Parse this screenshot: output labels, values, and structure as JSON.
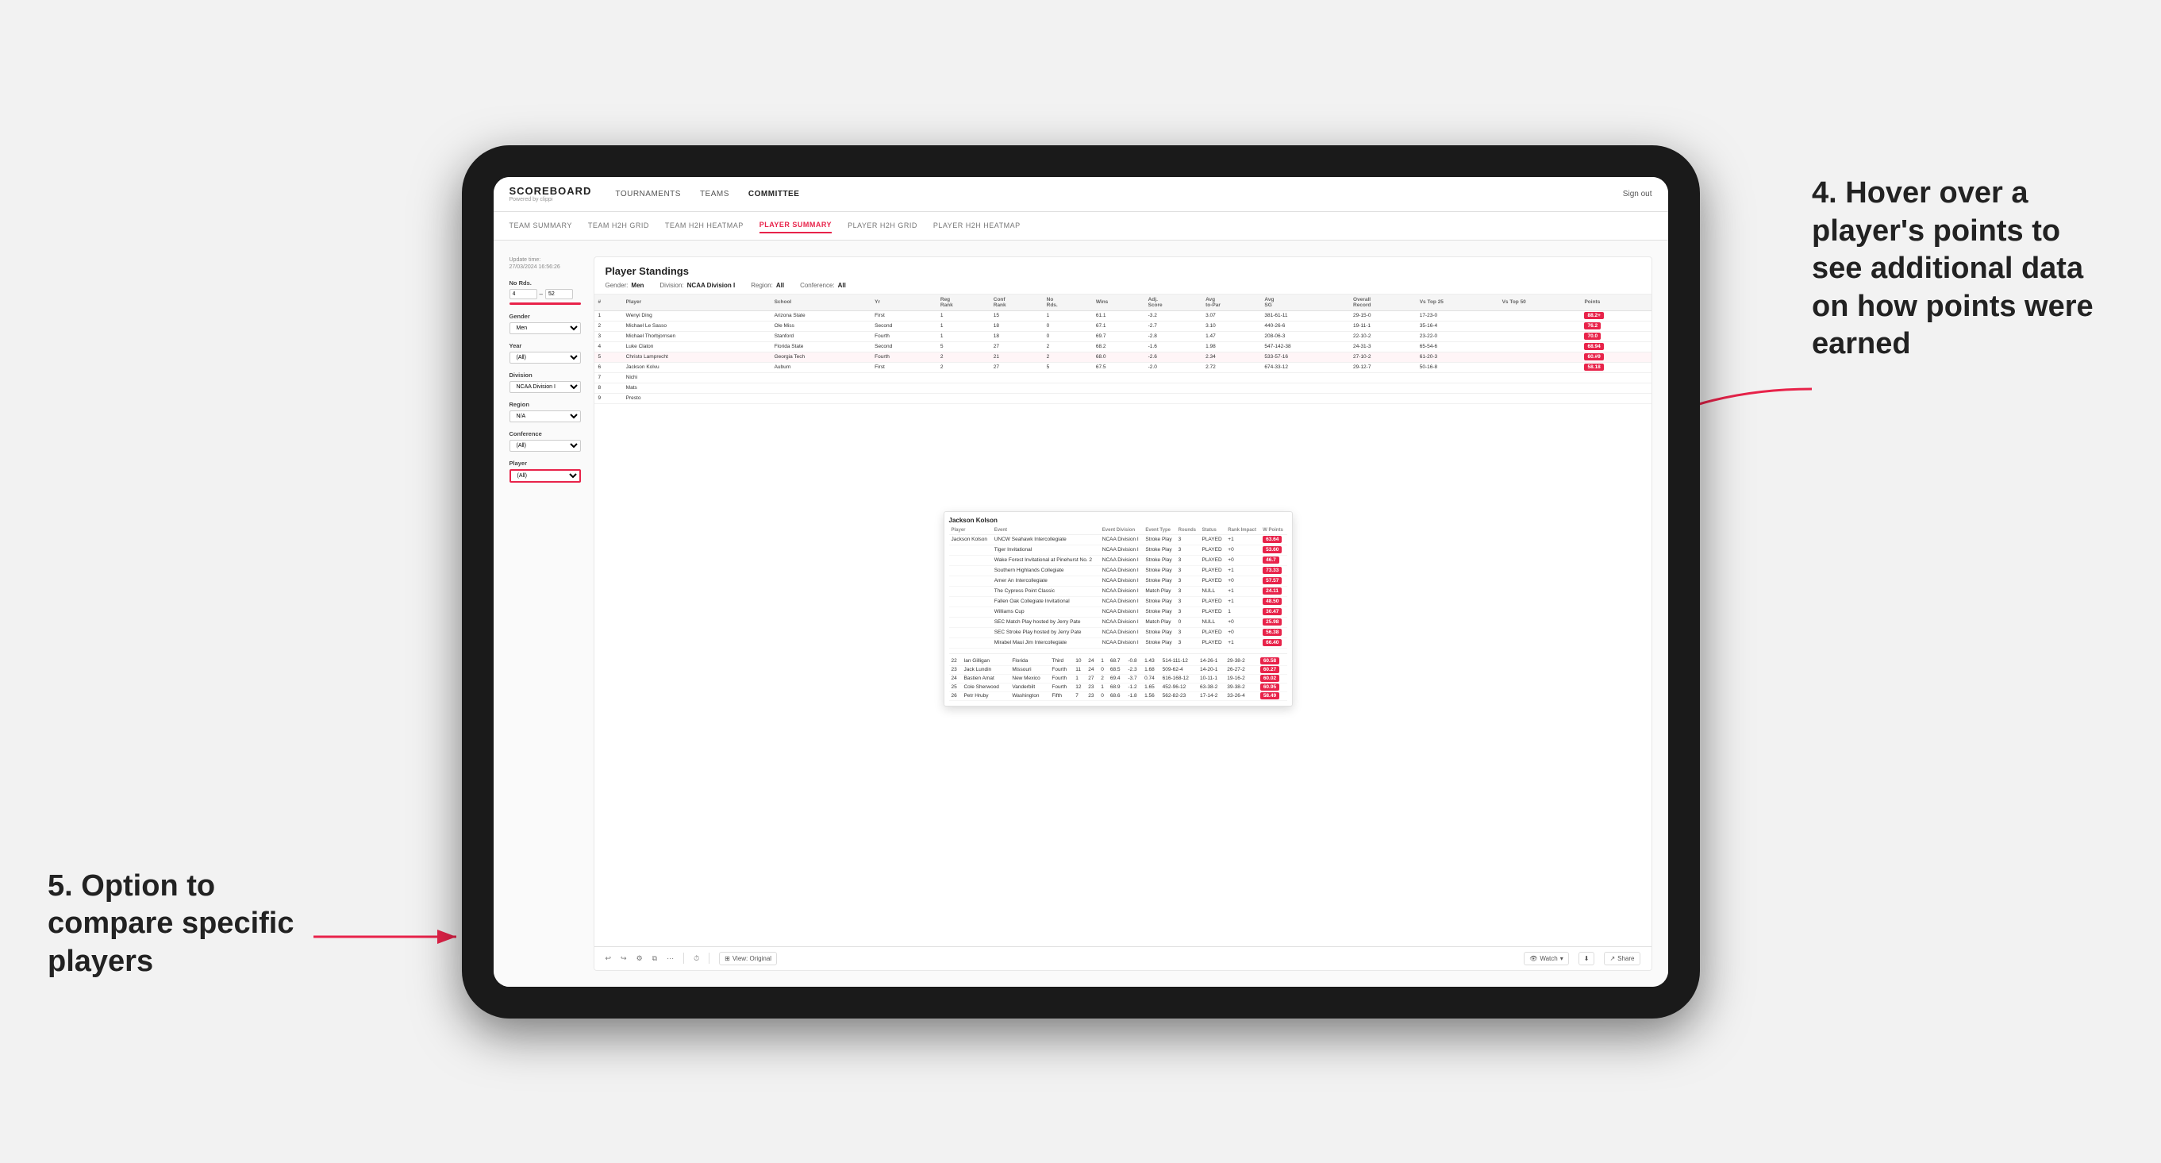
{
  "app": {
    "logo": "SCOREBOARD",
    "logo_sub": "Powered by clippi",
    "sign_out": "Sign out"
  },
  "nav": {
    "items": [
      {
        "label": "TOURNAMENTS",
        "active": false
      },
      {
        "label": "TEAMS",
        "active": false
      },
      {
        "label": "COMMITTEE",
        "active": true
      }
    ]
  },
  "sub_nav": {
    "items": [
      {
        "label": "TEAM SUMMARY",
        "active": false
      },
      {
        "label": "TEAM H2H GRID",
        "active": false
      },
      {
        "label": "TEAM H2H HEATMAP",
        "active": false
      },
      {
        "label": "PLAYER SUMMARY",
        "active": true
      },
      {
        "label": "PLAYER H2H GRID",
        "active": false
      },
      {
        "label": "PLAYER H2H HEATMAP",
        "active": false
      }
    ]
  },
  "sidebar": {
    "update_time_label": "Update time:",
    "update_time": "27/03/2024 16:56:26",
    "no_rds_label": "No Rds.",
    "no_rds_min": "4",
    "no_rds_max": "52",
    "gender_label": "Gender",
    "gender_value": "Men",
    "year_label": "Year",
    "year_value": "(All)",
    "division_label": "Division",
    "division_value": "NCAA Division I",
    "region_label": "Region",
    "region_value": "N/A",
    "conference_label": "Conference",
    "conference_value": "(All)",
    "player_label": "Player",
    "player_value": "(All)"
  },
  "table": {
    "title": "Player Standings",
    "gender_label": "Gender:",
    "gender_val": "Men",
    "division_label": "Division:",
    "division_val": "NCAA Division I",
    "region_label": "Region:",
    "region_val": "All",
    "conference_label": "Conference:",
    "conference_val": "All",
    "columns": [
      "#",
      "Player",
      "School",
      "Yr",
      "Reg Rank",
      "Conf Rank",
      "No Rds.",
      "Wins",
      "Adj. Score",
      "Avg to-Par",
      "Avg SG",
      "Overall Record",
      "Vs Top 25",
      "Vs Top 50",
      "Points"
    ],
    "rows": [
      {
        "rank": "1",
        "player": "Wenyi Ding",
        "school": "Arizona State",
        "yr": "First",
        "reg_rank": "1",
        "conf_rank": "15",
        "no_rds": "1",
        "wins": "61.1",
        "adj_score": "-3.2",
        "avg_to_par": "3.07",
        "avg_sg": "381-61-11",
        "overall": "29-15-0",
        "vs25": "17-23-0",
        "vs50": "",
        "points": "88.2+",
        "points_color": "red"
      },
      {
        "rank": "2",
        "player": "Michael Le Sasso",
        "school": "Ole Miss",
        "yr": "Second",
        "reg_rank": "1",
        "conf_rank": "18",
        "no_rds": "0",
        "wins": "67.1",
        "adj_score": "-2.7",
        "avg_to_par": "3.10",
        "avg_sg": "440-26-6",
        "overall": "19-11-1",
        "vs25": "35-16-4",
        "vs50": "",
        "points": "76.2",
        "points_color": "red"
      },
      {
        "rank": "3",
        "player": "Michael Thorbjornsen",
        "school": "Stanford",
        "yr": "Fourth",
        "reg_rank": "1",
        "conf_rank": "18",
        "no_rds": "0",
        "wins": "69.7",
        "adj_score": "-2.8",
        "avg_to_par": "1.47",
        "avg_sg": "208-06-3",
        "overall": "22-10-2",
        "vs25": "23-22-0",
        "vs50": "",
        "points": "70.0",
        "points_color": "red"
      },
      {
        "rank": "4",
        "player": "Luke Claton",
        "school": "Florida State",
        "yr": "Second",
        "reg_rank": "5",
        "conf_rank": "27",
        "no_rds": "2",
        "wins": "68.2",
        "adj_score": "-1.6",
        "avg_to_par": "1.98",
        "avg_sg": "547-142-38",
        "overall": "24-31-3",
        "vs25": "65-54-6",
        "vs50": "",
        "points": "68.94",
        "points_color": "red"
      },
      {
        "rank": "5",
        "player": "Christo Lamprecht",
        "school": "Georgia Tech",
        "yr": "Fourth",
        "reg_rank": "2",
        "conf_rank": "21",
        "no_rds": "2",
        "wins": "68.0",
        "adj_score": "-2.6",
        "avg_to_par": "2.34",
        "avg_sg": "533-57-16",
        "overall": "27-10-2",
        "vs25": "61-20-3",
        "vs50": "",
        "points": "60.#9",
        "points_color": "red"
      },
      {
        "rank": "6",
        "player": "Jackson Koivu",
        "school": "Auburn",
        "yr": "First",
        "reg_rank": "2",
        "conf_rank": "27",
        "no_rds": "5",
        "wins": "67.5",
        "adj_score": "-2.0",
        "avg_to_par": "2.72",
        "avg_sg": "674-33-12",
        "overall": "29-12-7",
        "vs25": "50-16-8",
        "vs50": "",
        "points": "58.18",
        "points_color": "red"
      },
      {
        "rank": "7",
        "player": "Nichi",
        "school": "",
        "yr": "",
        "reg_rank": "",
        "conf_rank": "",
        "no_rds": "",
        "wins": "",
        "adj_score": "",
        "avg_to_par": "",
        "avg_sg": "",
        "overall": "",
        "vs25": "",
        "vs50": "",
        "points": "",
        "points_color": ""
      },
      {
        "rank": "8",
        "player": "Mats",
        "school": "",
        "yr": "",
        "reg_rank": "",
        "conf_rank": "",
        "no_rds": "",
        "wins": "",
        "adj_score": "",
        "avg_to_par": "",
        "avg_sg": "",
        "overall": "",
        "vs25": "",
        "vs50": "",
        "points": "",
        "points_color": ""
      },
      {
        "rank": "9",
        "player": "Presto",
        "school": "",
        "yr": "",
        "reg_rank": "",
        "conf_rank": "",
        "no_rds": "",
        "wins": "",
        "adj_score": "",
        "avg_to_par": "",
        "avg_sg": "",
        "overall": "",
        "vs25": "",
        "vs50": "",
        "points": "",
        "points_color": ""
      }
    ]
  },
  "event_popup": {
    "player_name": "Jackson Kolson",
    "columns": [
      "Player",
      "Event",
      "Event Division",
      "Event Type",
      "Rounds",
      "Status",
      "Rank Impact",
      "W Points"
    ],
    "rows": [
      {
        "player": "Jackson Kolson",
        "event": "UNCW Seahawk Intercollegiate",
        "division": "NCAA Division I",
        "type": "Stroke Play",
        "rounds": "3",
        "status": "PLAYED",
        "rank": "+1",
        "points": "63.64"
      },
      {
        "player": "",
        "event": "Tiger Invitational",
        "division": "NCAA Division I",
        "type": "Stroke Play",
        "rounds": "3",
        "status": "PLAYED",
        "rank": "+0",
        "points": "53.60"
      },
      {
        "player": "",
        "event": "Wake Forest Invitational at Pinehurst No. 2",
        "division": "NCAA Division I",
        "type": "Stroke Play",
        "rounds": "3",
        "status": "PLAYED",
        "rank": "+0",
        "points": "46.7"
      },
      {
        "player": "",
        "event": "Southern Highlands Collegiate",
        "division": "NCAA Division I",
        "type": "Stroke Play",
        "rounds": "3",
        "status": "PLAYED",
        "rank": "+1",
        "points": "73.33"
      },
      {
        "player": "",
        "event": "Amer An Intercollegiate",
        "division": "NCAA Division I",
        "type": "Stroke Play",
        "rounds": "3",
        "status": "PLAYED",
        "rank": "+0",
        "points": "57.57"
      },
      {
        "player": "",
        "event": "The Cypress Point Classic",
        "division": "NCAA Division I",
        "type": "Match Play",
        "rounds": "3",
        "status": "NULL",
        "rank": "+1",
        "points": "24.11"
      },
      {
        "player": "",
        "event": "Fallen Oak Collegiate Invitational",
        "division": "NCAA Division I",
        "type": "Stroke Play",
        "rounds": "3",
        "status": "PLAYED",
        "rank": "+1",
        "points": "48.50"
      },
      {
        "player": "",
        "event": "Williams Cup",
        "division": "NCAA Division I",
        "type": "Stroke Play",
        "rounds": "3",
        "status": "PLAYED",
        "rank": "1",
        "points": "30.47"
      },
      {
        "player": "",
        "event": "SEC Match Play hosted by Jerry Pate",
        "division": "NCAA Division I",
        "type": "Match Play",
        "rounds": "0",
        "status": "NULL",
        "rank": "+0",
        "points": "25.98"
      },
      {
        "player": "",
        "event": "SEC Stroke Play hosted by Jerry Pate",
        "division": "NCAA Division I",
        "type": "Stroke Play",
        "rounds": "3",
        "status": "PLAYED",
        "rank": "+0",
        "points": "56.38"
      },
      {
        "player": "",
        "event": "Mirabel Maui Jim Intercollegiate",
        "division": "NCAA Division I",
        "type": "Stroke Play",
        "rounds": "3",
        "status": "PLAYED",
        "rank": "+1",
        "points": "66.40"
      }
    ]
  },
  "lower_rows": [
    {
      "rank": "22",
      "player": "Ian Gilligan",
      "school": "Florida",
      "yr": "Third",
      "reg_rank": "10",
      "conf_rank": "24",
      "no_rds": "1",
      "wins": "68.7",
      "adj_score": "-0.8",
      "avg_to_par": "1.43",
      "avg_sg": "514-111-12",
      "overall": "14-26-1",
      "vs25": "29-38-2",
      "vs50": "",
      "points": "60.58"
    },
    {
      "rank": "23",
      "player": "Jack Lundin",
      "school": "Missouri",
      "yr": "Fourth",
      "reg_rank": "11",
      "conf_rank": "24",
      "no_rds": "0",
      "wins": "68.5",
      "adj_score": "-2.3",
      "avg_to_par": "1.68",
      "avg_sg": "509-62-4",
      "overall": "14-20-1",
      "vs25": "26-27-2",
      "vs50": "",
      "points": "60.27"
    },
    {
      "rank": "24",
      "player": "Bastien Amat",
      "school": "New Mexico",
      "yr": "Fourth",
      "reg_rank": "1",
      "conf_rank": "27",
      "no_rds": "2",
      "wins": "69.4",
      "adj_score": "-3.7",
      "avg_to_par": "0.74",
      "avg_sg": "616-168-12",
      "overall": "10-11-1",
      "vs25": "19-16-2",
      "vs50": "",
      "points": "60.02"
    },
    {
      "rank": "25",
      "player": "Cole Sherwood",
      "school": "Vanderbilt",
      "yr": "Fourth",
      "reg_rank": "12",
      "conf_rank": "23",
      "no_rds": "1",
      "wins": "68.9",
      "adj_score": "-1.2",
      "avg_to_par": "1.65",
      "avg_sg": "452-96-12",
      "overall": "63-38-2",
      "vs25": "39-38-2",
      "vs50": "",
      "points": "60.95"
    },
    {
      "rank": "26",
      "player": "Petr Hruby",
      "school": "Washington",
      "yr": "Fifth",
      "reg_rank": "7",
      "conf_rank": "23",
      "no_rds": "0",
      "wins": "68.6",
      "adj_score": "-1.8",
      "avg_to_par": "1.56",
      "avg_sg": "562-82-23",
      "overall": "17-14-2",
      "vs25": "33-26-4",
      "vs50": "",
      "points": "58.49"
    }
  ],
  "toolbar": {
    "view_original": "View: Original",
    "watch": "Watch",
    "share": "Share"
  },
  "annotations": {
    "right": {
      "number": "4.",
      "text": " Hover over a player's points to see additional data on how points were earned"
    },
    "left": {
      "number": "5.",
      "text": " Option to compare specific players"
    }
  }
}
